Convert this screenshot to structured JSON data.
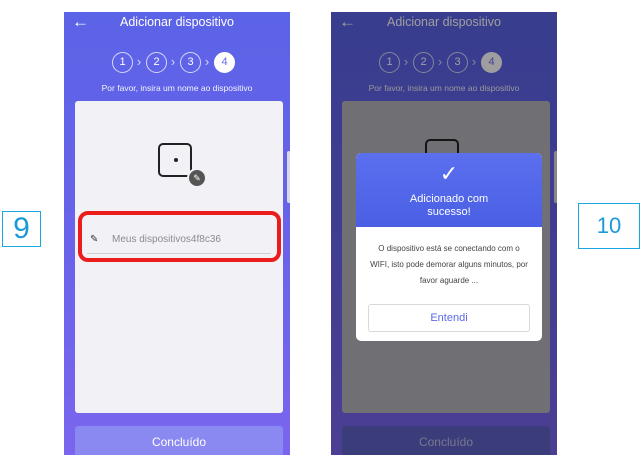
{
  "left_screen": {
    "header": {
      "back_icon": "arrow-left-icon",
      "title": "Adicionar dispositivo"
    },
    "steps": [
      "1",
      "2",
      "3",
      "4"
    ],
    "active_step": 4,
    "instruction": "Por favor, insira um nome ao dispositivo",
    "device_icon": "device-edit-icon",
    "name_field": {
      "icon": "pencil-icon",
      "value": "Meus dispositivos4f8c36"
    },
    "done_button": "Concluído"
  },
  "right_screen": {
    "header": {
      "back_icon": "arrow-left-icon",
      "title": "Adicionar dispositivo"
    },
    "steps": [
      "1",
      "2",
      "3",
      "4"
    ],
    "instruction": "Por favor, insira um nome ao dispositivo",
    "dialog": {
      "icon": "check-icon",
      "title_line1": "Adicionado com",
      "title_line2": "sucesso!",
      "message_line1": "O dispositivo está se conectando com o",
      "message_line2": "WIFI, isto pode demorar alguns minutos, por",
      "message_line3": "favor aguarde ...",
      "button": "Entendi"
    },
    "done_button": "Concluído"
  },
  "labels": {
    "step9": "9",
    "step10": "10"
  },
  "colors": {
    "phone_bg": "#5b63e6",
    "highlight": "#ea1c1c",
    "label": "#1aa6e0",
    "dialog_header": "#4a5fe4"
  }
}
